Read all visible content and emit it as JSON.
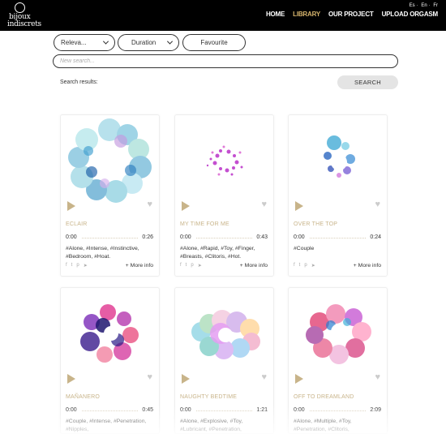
{
  "header": {
    "logo_line1": "bijoux",
    "logo_line2": "indiscrets",
    "languages": [
      "Es",
      "En",
      "Fr"
    ],
    "nav": [
      {
        "label": "HOME",
        "active": false
      },
      {
        "label": "LIBRARY",
        "active": true
      },
      {
        "label": "OUR PROJECT",
        "active": false
      },
      {
        "label": "UPLOAD ORGASM",
        "active": false
      }
    ]
  },
  "filters": {
    "sort_label": "Releva...",
    "duration_label": "Duration",
    "favourite_label": "Favourite"
  },
  "search": {
    "placeholder": "New search...",
    "results_label": "Search results:",
    "button_label": "SEARCH"
  },
  "cards": [
    {
      "title": "ECLAIR",
      "start": "0:00",
      "end": "0:26",
      "tags": "#Alone, #Intense, #Instinctive, #Bedroom, #Hoat.",
      "more": "+ More info"
    },
    {
      "title": "MY TIME FOR ME",
      "start": "0:00",
      "end": "0:43",
      "tags": "#Alone, #Rapid, #Toy, #Finger, #Breasts, #Clitoris, #Hot.",
      "more": "+ More info"
    },
    {
      "title": "OVER THE TOP",
      "start": "0:00",
      "end": "0:24",
      "tags": "#Couple",
      "more": "+ More info"
    },
    {
      "title": "MAÑANERO",
      "start": "0:00",
      "end": "0:45",
      "tags": "#Couple, #Intense, #Penetration, #Nipples,",
      "more": ""
    },
    {
      "title": "NAUGHTY BEDTIME",
      "start": "0:00",
      "end": "1:21",
      "tags": "#Alone, #Explosive, #Toy, #Lubricant, #Penetration,",
      "more": ""
    },
    {
      "title": "OFF TO DREAMLAND",
      "start": "0:00",
      "end": "2:09",
      "tags": "#Alone, #Multiple, #Toy, #Penetration, #Clitoris,",
      "more": ""
    }
  ],
  "social_icons": [
    "facebook-icon",
    "twitter-icon",
    "pinterest-icon",
    "telegram-icon"
  ],
  "colors": {
    "accent": "#d7b56d",
    "gold_muted": "#c8b48a",
    "header_bg": "#000000"
  }
}
